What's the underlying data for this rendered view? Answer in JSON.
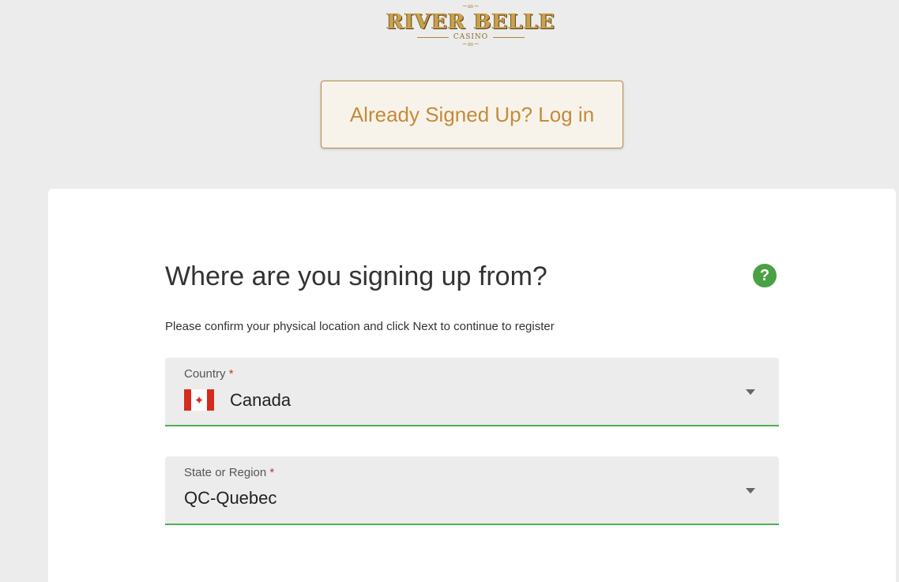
{
  "logo": {
    "name": "RIVER BELLE",
    "sub": "CASINO",
    "flourish": "~∞~"
  },
  "login_button": {
    "label": "Already Signed Up? Log in"
  },
  "location_form": {
    "title": "Where are you signing up from?",
    "help_icon": {
      "name": "help-icon",
      "glyph": "?",
      "color": "#4aa045"
    },
    "subtitle": "Please confirm your physical location and click Next to continue to register",
    "country": {
      "label": "Country",
      "required_marker": "*",
      "value": "Canada",
      "flag_icon": "canada-flag-icon",
      "flag_glyph": "✦"
    },
    "region": {
      "label": "State or Region",
      "required_marker": "*",
      "value": "QC-Quebec"
    },
    "accent_color": "#4caf50"
  },
  "colors": {
    "brand_gold": "#c58b3a",
    "background": "#ececec",
    "card": "#ffffff"
  }
}
